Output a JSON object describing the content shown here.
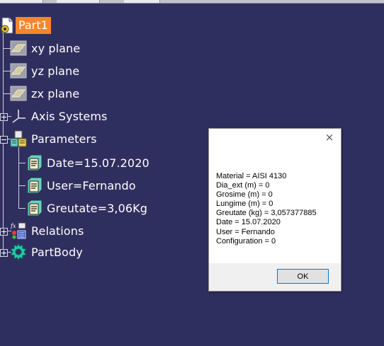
{
  "tree": {
    "root": {
      "label": "Part1",
      "icon": "part-icon"
    },
    "planes": [
      {
        "label": "xy plane",
        "icon": "plane-icon"
      },
      {
        "label": "yz plane",
        "icon": "plane-icon"
      },
      {
        "label": "zx plane",
        "icon": "plane-icon"
      }
    ],
    "axis_systems": {
      "label": "Axis Systems",
      "icon": "axis-system-icon"
    },
    "parameters": {
      "label": "Parameters",
      "icon": "parameters-icon",
      "children": [
        {
          "label": "Date=15.07.2020",
          "icon": "parameter-icon"
        },
        {
          "label": "User=Fernando",
          "icon": "parameter-icon"
        },
        {
          "label": "Greutate=3,06Kg",
          "icon": "parameter-icon"
        }
      ]
    },
    "relations": {
      "label": "Relations",
      "icon": "relations-icon"
    },
    "partbody": {
      "label": "PartBody",
      "icon": "partbody-icon"
    }
  },
  "dialog": {
    "close_label": "×",
    "lines": [
      "Material = AISI 4130",
      "Dia_ext (m) = 0",
      "Grosime (m) = 0",
      "Lungime (m) = 0",
      "Greutate (kg) = 3,057377885",
      "Date = 15.07.2020",
      "User = Fernando",
      "Configuration = 0"
    ],
    "ok_label": "OK"
  },
  "colors": {
    "background": "#2f2f5f",
    "selection": "#f5872a"
  }
}
